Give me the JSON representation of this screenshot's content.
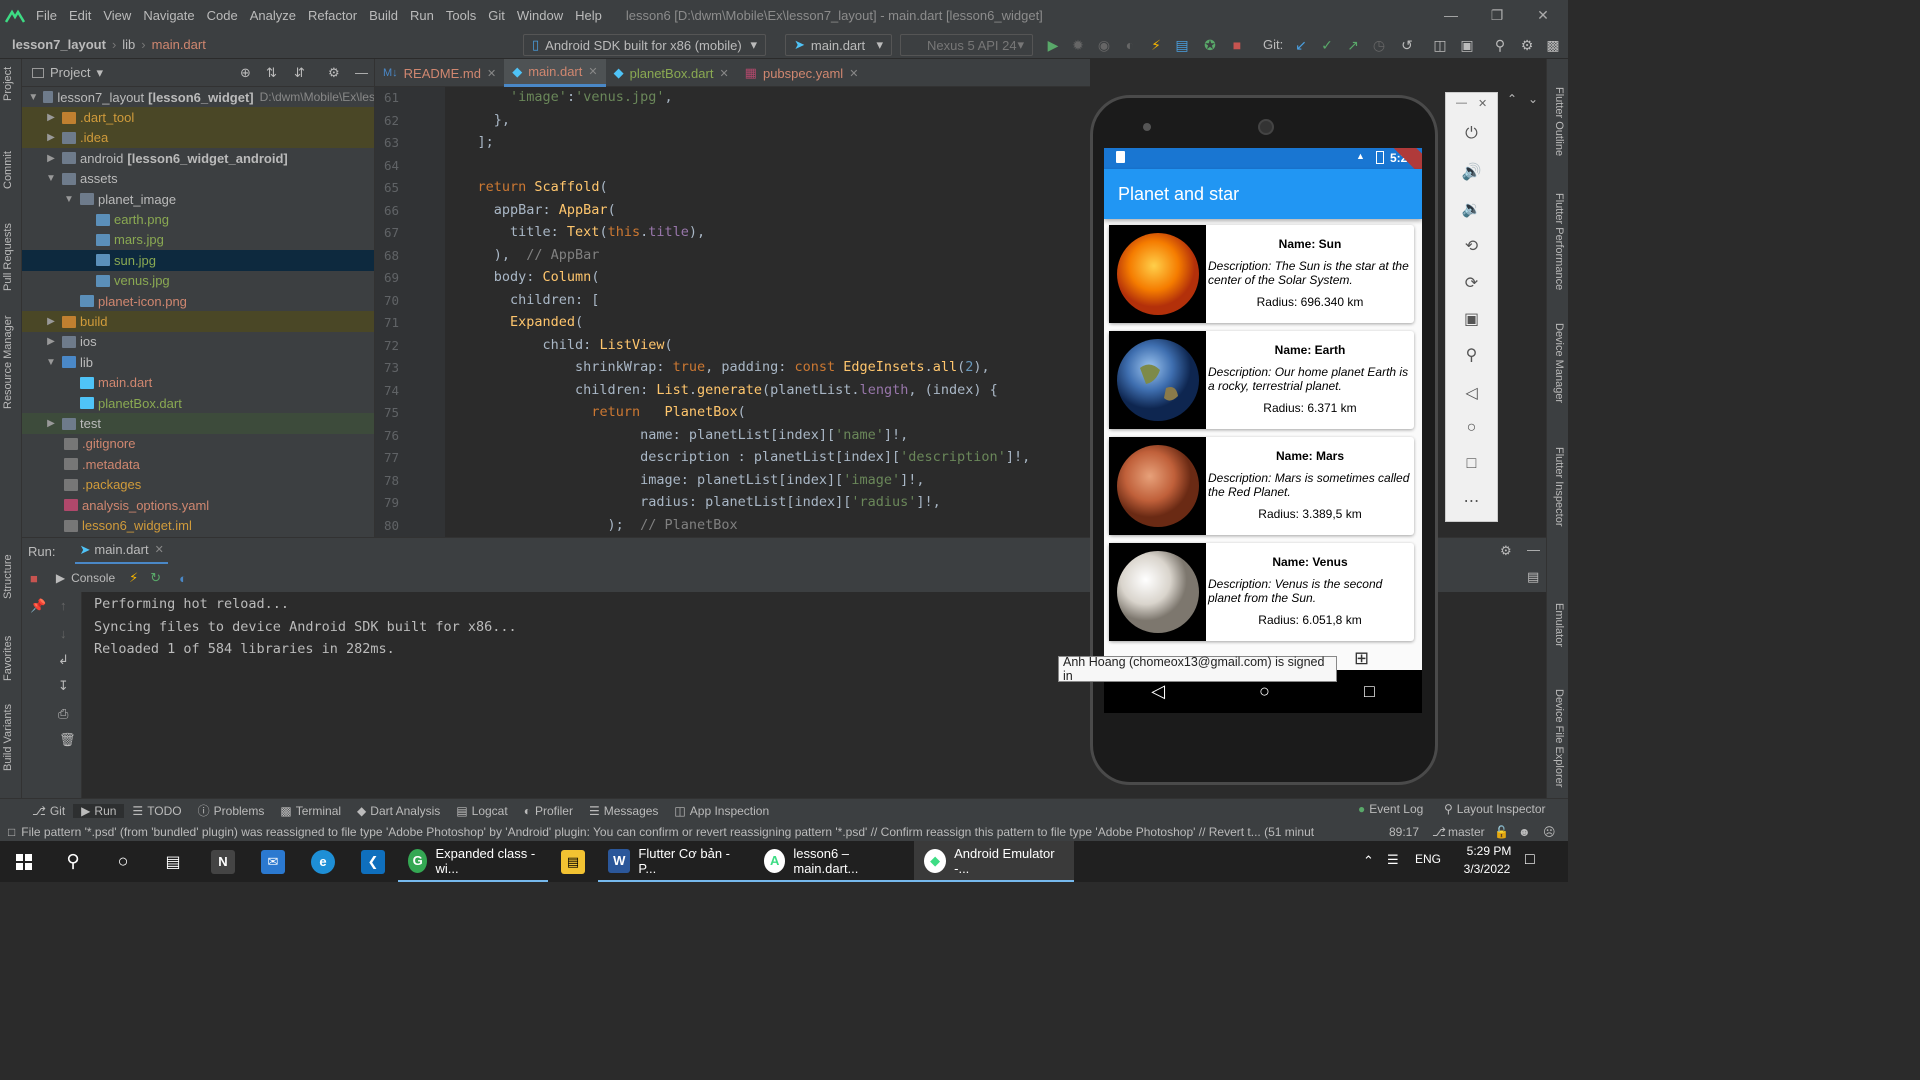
{
  "menubar": {
    "items": [
      "File",
      "Edit",
      "View",
      "Navigate",
      "Code",
      "Analyze",
      "Refactor",
      "Build",
      "Run",
      "Tools",
      "Git",
      "Window",
      "Help"
    ],
    "window_title": "lesson6 [D:\\dwm\\Mobile\\Ex\\lesson7_layout] - main.dart [lesson6_widget]"
  },
  "toolbar": {
    "crumbs": [
      "lesson7_layout",
      "lib",
      "main.dart"
    ],
    "device_combo": "Android SDK built for x86 (mobile)",
    "run_config": "main.dart",
    "avd_combo": "Nexus 5 API 24",
    "git_label": "Git:"
  },
  "project_panel": {
    "title": "Project",
    "tree": [
      {
        "label": "lesson7_layout",
        "extra": "[lesson6_widget]",
        "path": "D:\\dwm\\Mobile\\Ex\\les"
      },
      {
        "label": ".dart_tool"
      },
      {
        "label": ".idea"
      },
      {
        "label": "android",
        "extra": "[lesson6_widget_android]"
      },
      {
        "label": "assets"
      },
      {
        "label": "planet_image"
      },
      {
        "label": "earth.png"
      },
      {
        "label": "mars.jpg"
      },
      {
        "label": "sun.jpg"
      },
      {
        "label": "venus.jpg"
      },
      {
        "label": "planet-icon.png"
      },
      {
        "label": "build"
      },
      {
        "label": "ios"
      },
      {
        "label": "lib"
      },
      {
        "label": "main.dart"
      },
      {
        "label": "planetBox.dart"
      },
      {
        "label": "test"
      },
      {
        "label": ".gitignore"
      },
      {
        "label": ".metadata"
      },
      {
        "label": ".packages"
      },
      {
        "label": "analysis_options.yaml"
      },
      {
        "label": "lesson6_widget.iml"
      }
    ]
  },
  "editor": {
    "tabs": [
      "README.md",
      "main.dart",
      "planetBox.dart",
      "pubspec.yaml"
    ],
    "line_numbers": [
      "61",
      "62",
      "63",
      "64",
      "65",
      "66",
      "67",
      "68",
      "69",
      "70",
      "71",
      "72",
      "73",
      "74",
      "75",
      "76",
      "77",
      "78",
      "79",
      "80"
    ]
  },
  "run_panel": {
    "label": "Run:",
    "tab": "main.dart",
    "console_label": "Console",
    "lines": [
      "Performing hot reload...",
      "Syncing files to device Android SDK built for x86...",
      "Reloaded 1 of 584 libraries in 282ms."
    ]
  },
  "bottom_tools": {
    "left": [
      "Git",
      "Run",
      "TODO",
      "Problems",
      "Terminal",
      "Dart Analysis",
      "Logcat",
      "Profiler",
      "Messages",
      "App Inspection"
    ],
    "right": [
      "Event Log",
      "Layout Inspector"
    ]
  },
  "statusbar": {
    "message": "File pattern '*.psd' (from 'bundled' plugin) was reassigned to file type 'Adobe Photoshop' by 'Android' plugin: You can confirm or revert reassigning pattern '*.psd' // Confirm reassign this pattern to file type 'Adobe Photoshop' // Revert t... (51 minut",
    "position": "89:17",
    "branch": "master"
  },
  "left_stripe": [
    "Project",
    "Commit",
    "Pull Requests",
    "Resource Manager",
    "Structure",
    "Favorites",
    "Build Variants"
  ],
  "right_stripe": [
    "Flutter Outline",
    "Flutter Performance",
    "Device Manager",
    "Flutter Inspector",
    "Emulator",
    "Device File Explorer"
  ],
  "phone": {
    "time": "5:29",
    "app_title": "Planet and star",
    "planets": [
      {
        "name": "Name: Sun",
        "description": "Description: The Sun is the star at the center of the Solar System.",
        "radius": "Radius: 696.340 km",
        "color": "#f57c00"
      },
      {
        "name": "Name: Earth",
        "description": "Description: Our home planet Earth is a rocky, terrestrial planet.",
        "radius": "Radius: 6.371 km",
        "color": "#3f6fb0"
      },
      {
        "name": "Name: Mars",
        "description": "Description: Mars is sometimes called the Red Planet.",
        "radius": "Radius: 3.389,5 km",
        "color": "#c0603a"
      },
      {
        "name": "Name: Venus",
        "description": "Description: Venus is the second planet from the Sun.",
        "radius": "Radius: 6.051,8 km",
        "color": "#d9d4cc"
      }
    ],
    "tooltip": "Anh Hoang (chomeox13@gmail.com) is signed in"
  },
  "taskbar": {
    "apps": [
      "Expanded class - wi...",
      "Flutter Cơ bản - P...",
      "lesson6 – main.dart...",
      "Android Emulator -..."
    ],
    "lang": "ENG",
    "time": "5:29 PM",
    "date": "3/3/2022"
  }
}
